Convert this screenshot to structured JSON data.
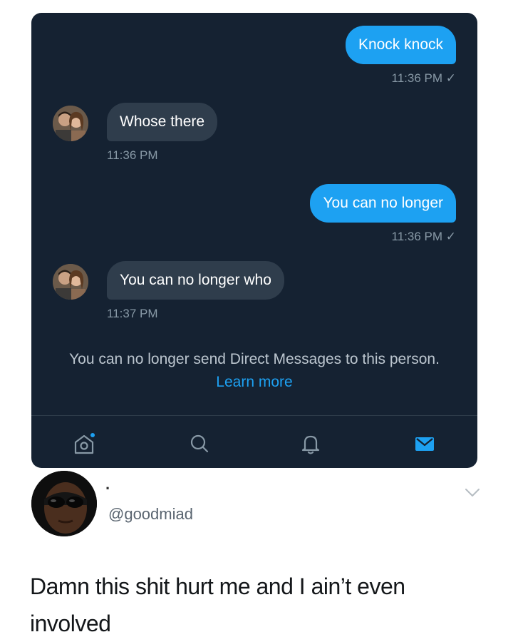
{
  "conversation": {
    "messages": [
      {
        "direction": "sent",
        "text": "Knock knock",
        "meta": "11:36 PM ✓"
      },
      {
        "direction": "received",
        "text": "Whose there",
        "meta": "11:36 PM"
      },
      {
        "direction": "sent",
        "text": "You can no longer",
        "meta": "11:36 PM ✓"
      },
      {
        "direction": "received",
        "text": "You can no longer who",
        "meta": "11:37 PM"
      }
    ],
    "notice": {
      "text": "You can no longer send Direct Messages to this person.",
      "link_label": "Learn more"
    }
  },
  "tab_bar": {
    "icons": [
      "home-icon",
      "search-icon",
      "notifications-icon",
      "messages-icon"
    ],
    "active_color": "#1da1f2",
    "inactive_color": "#8899a6"
  },
  "post": {
    "author_dot": "·",
    "handle": "@goodmiad",
    "text": "Damn this shit hurt me and I ain’t even involved"
  },
  "colors": {
    "card_background": "#152232",
    "sent_bubble": "#1da1f2",
    "received_bubble": "#2f3d4c",
    "link": "#1da1f2"
  }
}
